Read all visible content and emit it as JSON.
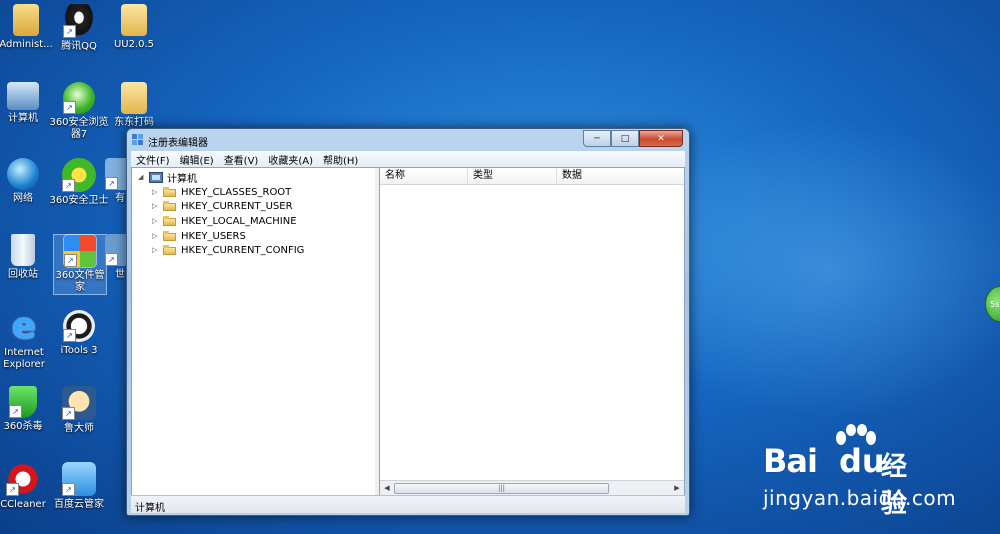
{
  "desktop": {
    "icons": [
      {
        "label": "Administ...",
        "shortcut": false
      },
      {
        "label": "腾讯QQ",
        "shortcut": true
      },
      {
        "label": "UU2.0.5",
        "shortcut": false
      },
      {
        "label": "计算机",
        "shortcut": false
      },
      {
        "label": "360安全浏览器7",
        "shortcut": true
      },
      {
        "label": "东东打码",
        "shortcut": false
      },
      {
        "label": "网络",
        "shortcut": false
      },
      {
        "label": "360安全卫士",
        "shortcut": true
      },
      {
        "label": "有",
        "shortcut": true
      },
      {
        "label": "回收站",
        "shortcut": false
      },
      {
        "label": "360文件管家",
        "shortcut": true
      },
      {
        "label": "世",
        "shortcut": true
      },
      {
        "label": "Internet Explorer",
        "shortcut": false
      },
      {
        "label": "iTools 3",
        "shortcut": true
      },
      {
        "label": "360杀毒",
        "shortcut": true
      },
      {
        "label": "鲁大师",
        "shortcut": true
      },
      {
        "label": "CCleaner",
        "shortcut": true
      },
      {
        "label": "百度云管家",
        "shortcut": true
      }
    ],
    "right_badge": "5s"
  },
  "window": {
    "title": "注册表编辑器",
    "controls": {
      "minimize": "─",
      "maximize": "□",
      "close": "✕"
    },
    "menu": [
      "文件(F)",
      "编辑(E)",
      "查看(V)",
      "收藏夹(A)",
      "帮助(H)"
    ],
    "tree": {
      "root": "计算机",
      "keys": [
        "HKEY_CLASSES_ROOT",
        "HKEY_CURRENT_USER",
        "HKEY_LOCAL_MACHINE",
        "HKEY_USERS",
        "HKEY_CURRENT_CONFIG"
      ]
    },
    "list_columns": [
      "名称",
      "类型",
      "数据"
    ],
    "scroll_grip": "|||",
    "status": "计算机"
  },
  "watermark": {
    "brand_a": "Bai",
    "brand_b": "du",
    "brand_c": "经验",
    "url": "jingyan.baidu.com"
  }
}
